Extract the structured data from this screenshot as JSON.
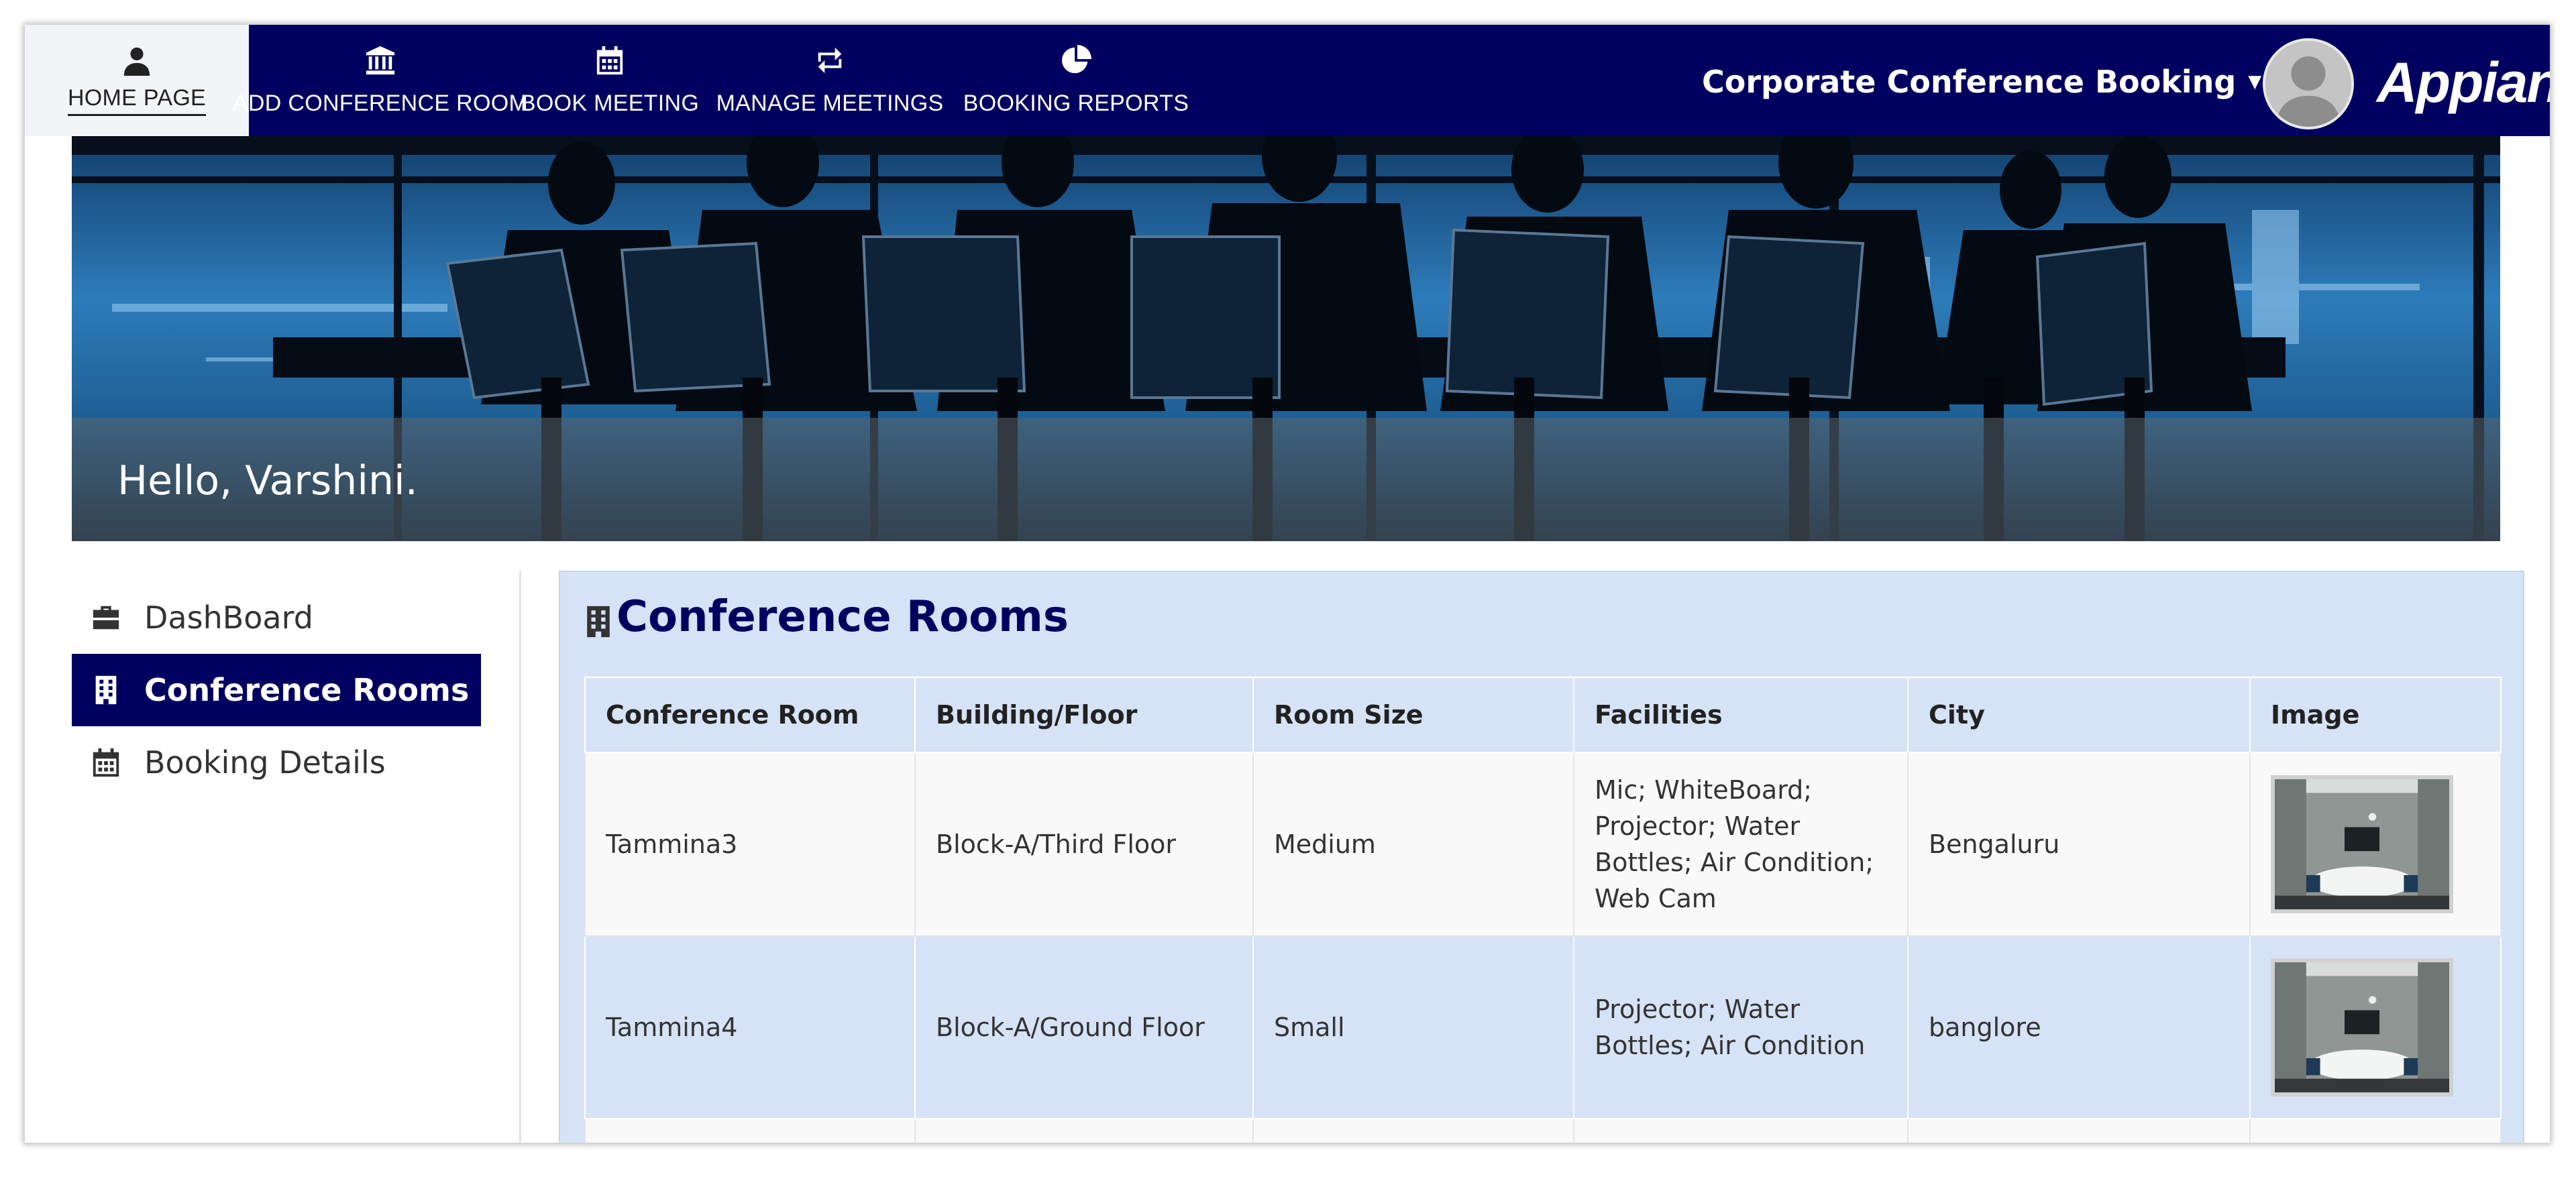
{
  "nav": {
    "tabs": [
      {
        "label": "HOME PAGE",
        "icon": "user-icon",
        "active": true
      },
      {
        "label": "ADD CONFERENCE ROOM",
        "icon": "bank-icon",
        "active": false
      },
      {
        "label": "BOOK MEETING",
        "icon": "calendar-icon",
        "active": false
      },
      {
        "label": "MANAGE MEETINGS",
        "icon": "retweet-icon",
        "active": false
      },
      {
        "label": "BOOKING REPORTS",
        "icon": "pie-chart-icon",
        "active": false
      }
    ],
    "site_title": "Corporate Conference Booking",
    "brand": "Appian",
    "colors": {
      "navbar": "#000060",
      "active_tab": "#f3f4f8"
    }
  },
  "banner": {
    "greeting": "Hello, Varshini."
  },
  "sidebar": {
    "items": [
      {
        "label": "DashBoard",
        "icon": "briefcase-icon",
        "active": false
      },
      {
        "label": "Conference Rooms",
        "icon": "building-icon",
        "active": true
      },
      {
        "label": "Booking Details",
        "icon": "calendar-icon",
        "active": false
      }
    ]
  },
  "main": {
    "title": "Conference Rooms",
    "title_icon": "building-icon",
    "table": {
      "headers": [
        "Conference Room",
        "Building/Floor",
        "Room Size",
        "Facilities",
        "City",
        "Image"
      ],
      "rows": [
        {
          "room": "Tammina3",
          "building": "Block-A/Third Floor",
          "size": "Medium",
          "facilities": "Mic; WhiteBoard; Projector; Water Bottles; Air Condition; Web Cam",
          "city": "Bengaluru"
        },
        {
          "room": "Tammina4",
          "building": "Block-A/Ground Floor",
          "size": "Small",
          "facilities": "Projector; Water Bottles; Air Condition",
          "city": "banglore"
        }
      ]
    },
    "colors": {
      "panel": "#d6e2f6",
      "title": "#000060"
    }
  }
}
